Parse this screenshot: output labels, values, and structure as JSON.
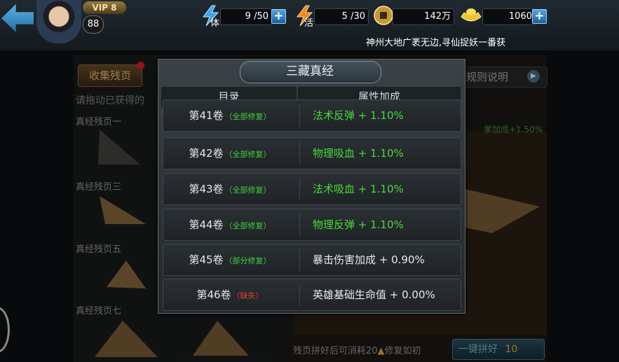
{
  "topbar": {
    "vip": "VIP 8",
    "level": "88",
    "stamina_label": "体",
    "stamina": "9 /50",
    "vigor_label": "活",
    "vigor": "5 /30",
    "coins": "142万",
    "gold": "1060",
    "marquee": "神州大地广袤无边,寻仙捉妖一番获"
  },
  "background": {
    "tab_collect": "收集残页",
    "hint": "请拖动已获得的",
    "fragments": [
      "真经残页一",
      "真经残页三",
      "真经残页五",
      "真经残页七"
    ],
    "rules": "规则说明",
    "bonus": "爹加成+1.50%",
    "bottom_note": "残页拼好后可消耗20",
    "bottom_note2": "修复如初",
    "one_key": "一键拼好",
    "one_key_cost": "10"
  },
  "modal": {
    "title": "三藏真经",
    "col_catalog": "目录",
    "col_bonus": "属性加成",
    "rows": [
      {
        "vol": "第41卷",
        "status": "（全部修复）",
        "status_color": "#3fcf3a",
        "attr": "法术反弹 + 1.10%",
        "attr_color": "#48d83a"
      },
      {
        "vol": "第42卷",
        "status": "（全部修复）",
        "status_color": "#3fcf3a",
        "attr": "物理吸血 + 1.10%",
        "attr_color": "#48d83a"
      },
      {
        "vol": "第43卷",
        "status": "（全部修复）",
        "status_color": "#3fcf3a",
        "attr": "法术吸血 + 1.10%",
        "attr_color": "#48d83a"
      },
      {
        "vol": "第44卷",
        "status": "（全部修复）",
        "status_color": "#3fcf3a",
        "attr": "物理反弹 + 1.10%",
        "attr_color": "#48d83a"
      },
      {
        "vol": "第45卷",
        "status": "（部分修复）",
        "status_color": "#3fcf3a",
        "attr": "暴击伤害加成 + 0.90%",
        "attr_color": "#e8e8e8"
      },
      {
        "vol": "第46卷",
        "status": "（缺失）",
        "status_color": "#e0402c",
        "attr": "英雄基础生命值 + 0.00%",
        "attr_color": "#e8e8e8"
      }
    ]
  },
  "icons": {
    "back": "back-arrow-icon",
    "stamina": "lightning-blue-icon",
    "vigor": "lightning-orange-icon",
    "coin": "copper-coin-icon",
    "gold": "gold-ingot-icon"
  }
}
